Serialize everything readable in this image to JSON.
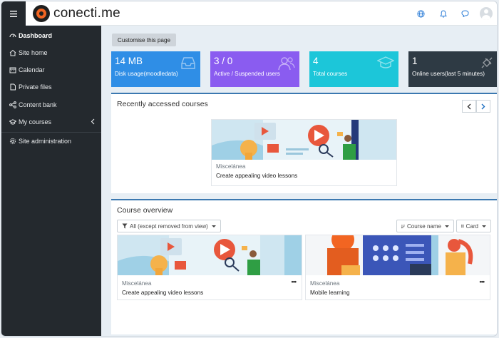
{
  "header": {
    "brand_name": "conecti.me",
    "icons": [
      "menu-icon",
      "globe-icon",
      "bell-icon",
      "chat-icon",
      "avatar"
    ]
  },
  "sidebar": {
    "items": [
      {
        "label": "Dashboard",
        "icon": "dashboard-icon",
        "active": true
      },
      {
        "label": "Site home",
        "icon": "home-icon"
      },
      {
        "label": "Calendar",
        "icon": "calendar-icon"
      },
      {
        "label": "Private files",
        "icon": "file-icon"
      },
      {
        "label": "Content bank",
        "icon": "share-icon"
      },
      {
        "label": "My courses",
        "icon": "graduation-cap-icon"
      },
      {
        "label": "Site administration",
        "icon": "gear-icon"
      }
    ]
  },
  "main": {
    "customise_label": "Customise this page",
    "stats": [
      {
        "value": "14 MB",
        "label": "Disk usage(moodledata)",
        "color": "#2f8ee6",
        "icon": "inbox-icon"
      },
      {
        "value": "3 / 0",
        "label": "Active / Suspended users",
        "color": "#8a5cf0",
        "icon": "users-icon"
      },
      {
        "value": "4",
        "label": "Total courses",
        "color": "#1cc6d9",
        "icon": "graduation-cap-icon"
      },
      {
        "value": "1",
        "label": "Online users(last 5 minutes)",
        "color": "#2e3a44",
        "icon": "plug-icon"
      }
    ],
    "recent": {
      "title": "Recently accessed courses",
      "course": {
        "category": "Miscelánea",
        "name": "Create appealing video lessons"
      }
    },
    "overview": {
      "title": "Course overview",
      "filter_label": "All (except removed from view)",
      "sort_label": "Course name",
      "view_label": "Card",
      "courses": [
        {
          "category": "Miscelánea",
          "name": "Create appealing video lessons"
        },
        {
          "category": "Miscelánea",
          "name": "Mobile learning"
        }
      ]
    }
  }
}
